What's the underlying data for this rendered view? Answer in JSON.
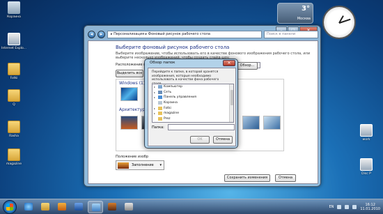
{
  "desktop": {
    "icons_left": [
      {
        "label": "Корзина",
        "kind": "bin"
      },
      {
        "label": "Internet Explo...",
        "kind": "shot"
      },
      {
        "label": "Fotki",
        "kind": "folder"
      },
      {
        "label": "Q",
        "kind": "folder"
      },
      {
        "label": "Rasha",
        "kind": "folder"
      },
      {
        "label": "magazine",
        "kind": "folder"
      }
    ],
    "icons_right": [
      {
        "label": "work",
        "kind": "shot"
      },
      {
        "label": "Disc P",
        "kind": "shot"
      }
    ]
  },
  "weather_gadget": {
    "temp": "3°",
    "city": "Москва"
  },
  "window": {
    "breadcrumb": "▸ Персонализация ▸ Фоновый рисунок рабочего стола",
    "search_placeholder": "Поиск в панели",
    "controls": {
      "minimize": "–",
      "maximize": "□",
      "close": "✕"
    },
    "heading": "Выберите фоновый рисунок рабочего стола",
    "description": "Выберите изображение, чтобы использовать его в качестве фонового изображения рабочего стола, или выберите несколько изображений, чтобы создать слайд-шоу.",
    "location_label": "Расположение изо",
    "location_value": "",
    "browse_button": "Обзор...",
    "select_all_button": "Выделить все",
    "group_windows": "Windows (1)",
    "group_arch": "Архитектура",
    "position_label": "Положение изобр",
    "position_value": "Заполнение",
    "save_button": "Сохранить изменения",
    "cancel_button": "Отмена"
  },
  "dialog": {
    "title": "Обзор папок",
    "close": "✕",
    "info": "Перейдите к папке, в которой хранятся изображения, которые необходимо использовать в качестве фона рабочего стола.",
    "tree": [
      {
        "label": "Компьютер",
        "color": "#7fa7cf",
        "arrow": "▸"
      },
      {
        "label": "Сеть",
        "color": "#6c8fb8",
        "arrow": "▸"
      },
      {
        "label": "Панель управления",
        "color": "#4b8fd6",
        "arrow": "▸"
      },
      {
        "label": "Корзина",
        "color": "#b9c7d4",
        "arrow": ""
      },
      {
        "label": "Fotki",
        "color": "#e8c25c",
        "arrow": "▸"
      },
      {
        "label": "magazine",
        "color": "#e8c25c",
        "arrow": "▸"
      },
      {
        "label": "Prez",
        "color": "#e8c25c",
        "arrow": ""
      }
    ],
    "folder_label": "Папка:",
    "folder_value": "",
    "ok_button": "OK",
    "cancel_button": "Отмена"
  },
  "taskbar": {
    "language": "EN",
    "time": "16:12",
    "date": "11.01.2010"
  }
}
